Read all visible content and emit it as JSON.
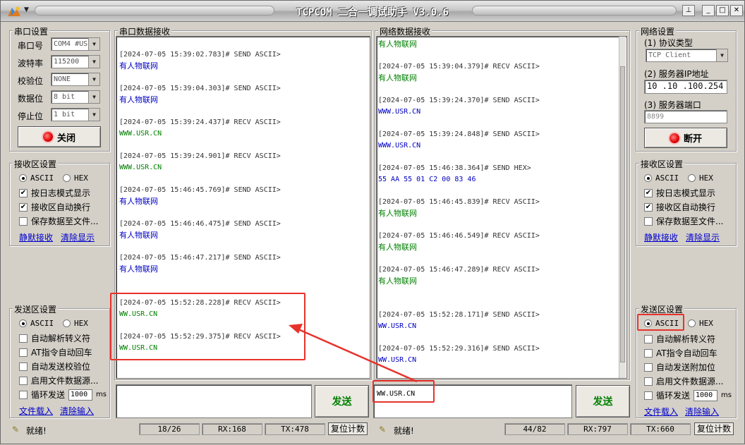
{
  "title": "TCPCOM 二合一调试助手  V3.0.6",
  "serial": {
    "group_title": "串口设置",
    "port_label": "串口号",
    "port_value": "COM4 #US",
    "baud_label": "波特率",
    "baud_value": "115200",
    "parity_label": "校验位",
    "parity_value": "NONE",
    "databits_label": "数据位",
    "databits_value": "8 bit",
    "stopbits_label": "停止位",
    "stopbits_value": "1 bit",
    "close_button": "关闭"
  },
  "left_recv": {
    "group_title": "接收区设置",
    "ascii": "ASCII",
    "hex": "HEX",
    "log_mode": "按日志模式显示",
    "auto_wrap": "接收区自动换行",
    "save_file": "保存数据至文件...",
    "silent_recv": "静默接收",
    "clear_display": "清除显示"
  },
  "left_send": {
    "group_title": "发送区设置",
    "ascii": "ASCII",
    "hex": "HEX",
    "auto_escape": "自动解析转义符",
    "at_auto_cr": "AT指令自动回车",
    "auto_checksum": "自动发送校验位",
    "file_source": "启用文件数据源...",
    "loop_send": "循环发送",
    "loop_ms": "1000",
    "ms_unit": "ms",
    "load_file": "文件载入",
    "clear_input": "清除输入"
  },
  "serial_log": {
    "title": "串口数据接收",
    "entries": [
      {
        "ts": "[2024-07-05 15:39:02.783]# SEND ASCII>",
        "data": "有人物联网",
        "color": "blue"
      },
      {
        "ts": "[2024-07-05 15:39:04.303]# SEND ASCII>",
        "data": "有人物联网",
        "color": "blue"
      },
      {
        "ts": "[2024-07-05 15:39:24.437]# RECV ASCII>",
        "data": "WWW.USR.CN",
        "color": "green"
      },
      {
        "ts": "[2024-07-05 15:39:24.901]# RECV ASCII>",
        "data": "WWW.USR.CN",
        "color": "green"
      },
      {
        "ts": "[2024-07-05 15:46:45.769]# SEND ASCII>",
        "data": "有人物联网",
        "color": "blue"
      },
      {
        "ts": "[2024-07-05 15:46:46.475]# SEND ASCII>",
        "data": "有人物联网",
        "color": "blue"
      },
      {
        "ts": "[2024-07-05 15:46:47.217]# SEND ASCII>",
        "data": "有人物联网",
        "color": "blue"
      },
      {
        "ts": "[2024-07-05 15:52:28.228]# RECV ASCII>",
        "data": "WW.USR.CN",
        "color": "green"
      },
      {
        "ts": "[2024-07-05 15:52:29.375]# RECV ASCII>",
        "data": "WW.USR.CN",
        "color": "green"
      }
    ]
  },
  "net_log": {
    "title": "网络数据接收",
    "first_line": "有人物联网",
    "entries": [
      {
        "ts": "[2024-07-05 15:39:04.379]# RECV ASCII>",
        "data": "有人物联网",
        "color": "green"
      },
      {
        "ts": "[2024-07-05 15:39:24.370]# SEND ASCII>",
        "data": "WWW.USR.CN",
        "color": "blue"
      },
      {
        "ts": "[2024-07-05 15:39:24.848]# SEND ASCII>",
        "data": "WWW.USR.CN",
        "color": "blue"
      },
      {
        "ts": "[2024-07-05 15:46:38.364]# SEND HEX>",
        "data": "55 AA 55 01 C2 00 83 46",
        "color": "blue"
      },
      {
        "ts": "[2024-07-05 15:46:45.839]# RECV ASCII>",
        "data": "有人物联网",
        "color": "green"
      },
      {
        "ts": "[2024-07-05 15:46:46.549]# RECV ASCII>",
        "data": "有人物联网",
        "color": "green"
      },
      {
        "ts": "[2024-07-05 15:46:47.289]# RECV ASCII>",
        "data": "有人物联网",
        "color": "green"
      },
      {
        "ts": "[2024-07-05 15:52:28.171]# SEND ASCII>",
        "data": "WW.USR.CN",
        "color": "blue"
      },
      {
        "ts": "[2024-07-05 15:52:29.316]# SEND ASCII>",
        "data": "WW.USR.CN",
        "color": "blue"
      }
    ]
  },
  "serial_send": {
    "input": "",
    "button": "发送"
  },
  "net_send": {
    "input": "WW.USR.CN",
    "button": "发送"
  },
  "network": {
    "group_title": "网络设置",
    "protocol_label": "(1) 协议类型",
    "protocol_value": "TCP Client",
    "ip_label": "(2) 服务器IP地址",
    "ip_value": "10 .10 .100.254",
    "port_label": "(3) 服务器端口",
    "port_value": "8899",
    "disconnect_button": "断开"
  },
  "right_recv": {
    "group_title": "接收区设置",
    "ascii": "ASCII",
    "hex": "HEX",
    "log_mode": "按日志模式显示",
    "auto_wrap": "接收区自动换行",
    "save_file": "保存数据至文件...",
    "silent_recv": "静默接收",
    "clear_display": "清除显示"
  },
  "right_send": {
    "group_title": "发送区设置",
    "ascii": "ASCII",
    "hex": "HEX",
    "auto_escape": "自动解析转义符",
    "at_auto_cr": "AT指令自动回车",
    "auto_append": "自动发送附加位",
    "file_source": "启用文件数据源...",
    "loop_send": "循环发送",
    "loop_ms": "1000",
    "ms_unit": "ms",
    "load_file": "文件载入",
    "clear_input": "清除输入"
  },
  "status_left": {
    "ready": "就绪!",
    "count": "18/26",
    "rx": "RX:168",
    "tx": "TX:478",
    "reset": "复位计数"
  },
  "status_right": {
    "ready": "就绪!",
    "count": "44/82",
    "rx": "RX:797",
    "tx": "TX:660",
    "reset": "复位计数"
  },
  "colors": {
    "send": "#0000c0",
    "recv": "#008000",
    "highlight": "#e8322c"
  }
}
